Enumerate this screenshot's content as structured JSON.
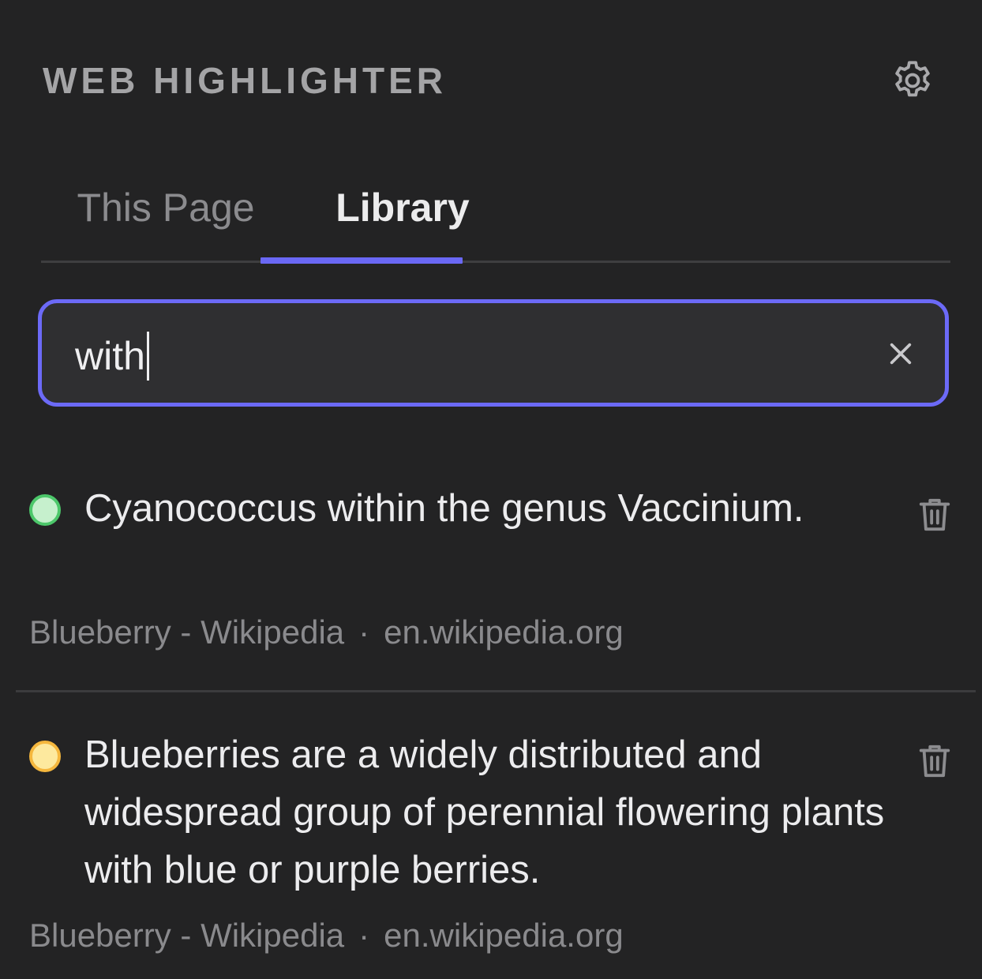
{
  "header": {
    "title": "WEB HIGHLIGHTER",
    "settings_icon": "gear-icon"
  },
  "tabs": [
    {
      "label": "This Page",
      "active": false
    },
    {
      "label": "Library",
      "active": true
    }
  ],
  "accent_color": "#6a68f5",
  "search": {
    "value": "with",
    "placeholder": "",
    "clear_icon": "close-icon"
  },
  "results": [
    {
      "text": "Cyanococcus within the genus Vaccinium.",
      "color_name": "green",
      "fill": "#c6f0cd",
      "border": "#4cc76a",
      "page_title": "Blueberry - Wikipedia",
      "separator": "·",
      "domain": "en.wikipedia.org",
      "delete_icon": "trash-icon"
    },
    {
      "text": "Blueberries are a widely distributed and widespread group of perennial flowering plants with blue or purple berries.",
      "color_name": "yellow",
      "fill": "#fde99e",
      "border": "#f5b73d",
      "page_title": "Blueberry - Wikipedia",
      "separator": "·",
      "domain": "en.wikipedia.org",
      "delete_icon": "trash-icon"
    }
  ]
}
